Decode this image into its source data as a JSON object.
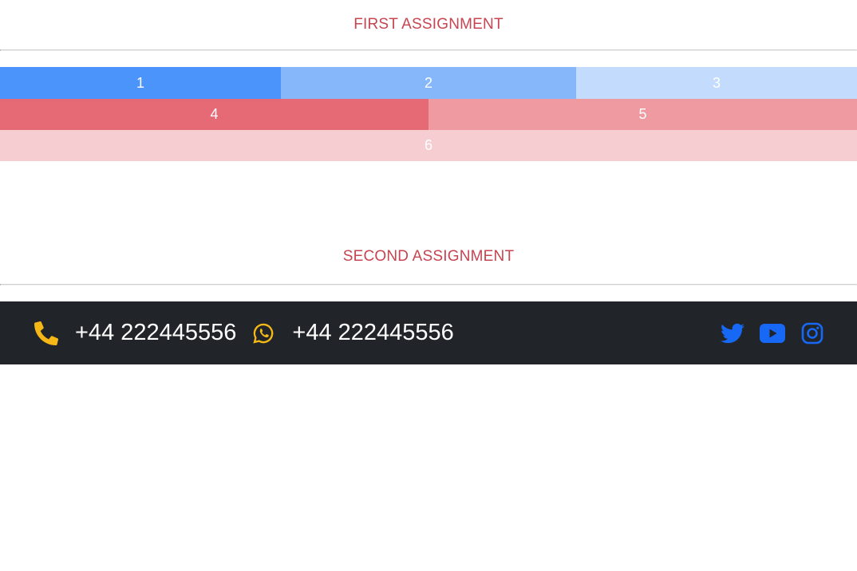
{
  "sections": {
    "first": {
      "title": "FIRST ASSIGNMENT"
    },
    "second": {
      "title": "SECOND ASSIGNMENT"
    }
  },
  "grid": {
    "cells": [
      "1",
      "2",
      "3",
      "4",
      "5",
      "6"
    ]
  },
  "contact": {
    "phone": {
      "icon": "phone-icon",
      "number": "+44 222445556"
    },
    "whatsapp": {
      "icon": "whatsapp-icon",
      "number": "+44 222445556"
    }
  },
  "social": [
    "twitter-icon",
    "youtube-icon",
    "instagram-icon"
  ],
  "colors": {
    "title": "#c64550",
    "bar_bg": "#212529",
    "contact_icon": "#f5b816",
    "social_icon": "#1769f5",
    "blue_1": "#4b94fb",
    "blue_2": "#87b7fb",
    "blue_3": "#c3dbfd",
    "red_1": "#e66a75",
    "red_2": "#ee9aa0",
    "red_3": "#f6cdd1"
  }
}
